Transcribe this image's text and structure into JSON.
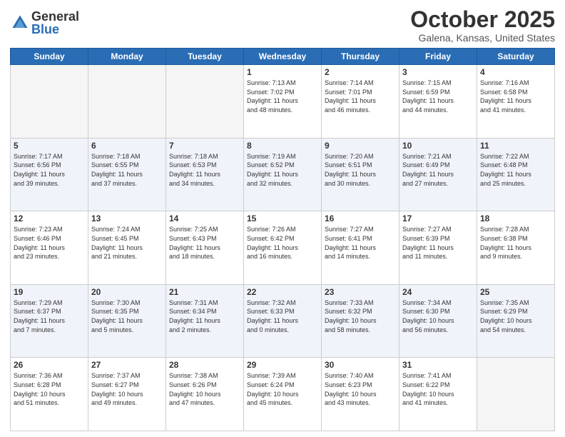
{
  "logo": {
    "general": "General",
    "blue": "Blue"
  },
  "title": "October 2025",
  "location": "Galena, Kansas, United States",
  "days_of_week": [
    "Sunday",
    "Monday",
    "Tuesday",
    "Wednesday",
    "Thursday",
    "Friday",
    "Saturday"
  ],
  "weeks": [
    [
      {
        "day": "",
        "info": ""
      },
      {
        "day": "",
        "info": ""
      },
      {
        "day": "",
        "info": ""
      },
      {
        "day": "1",
        "info": "Sunrise: 7:13 AM\nSunset: 7:02 PM\nDaylight: 11 hours\nand 48 minutes."
      },
      {
        "day": "2",
        "info": "Sunrise: 7:14 AM\nSunset: 7:01 PM\nDaylight: 11 hours\nand 46 minutes."
      },
      {
        "day": "3",
        "info": "Sunrise: 7:15 AM\nSunset: 6:59 PM\nDaylight: 11 hours\nand 44 minutes."
      },
      {
        "day": "4",
        "info": "Sunrise: 7:16 AM\nSunset: 6:58 PM\nDaylight: 11 hours\nand 41 minutes."
      }
    ],
    [
      {
        "day": "5",
        "info": "Sunrise: 7:17 AM\nSunset: 6:56 PM\nDaylight: 11 hours\nand 39 minutes."
      },
      {
        "day": "6",
        "info": "Sunrise: 7:18 AM\nSunset: 6:55 PM\nDaylight: 11 hours\nand 37 minutes."
      },
      {
        "day": "7",
        "info": "Sunrise: 7:18 AM\nSunset: 6:53 PM\nDaylight: 11 hours\nand 34 minutes."
      },
      {
        "day": "8",
        "info": "Sunrise: 7:19 AM\nSunset: 6:52 PM\nDaylight: 11 hours\nand 32 minutes."
      },
      {
        "day": "9",
        "info": "Sunrise: 7:20 AM\nSunset: 6:51 PM\nDaylight: 11 hours\nand 30 minutes."
      },
      {
        "day": "10",
        "info": "Sunrise: 7:21 AM\nSunset: 6:49 PM\nDaylight: 11 hours\nand 27 minutes."
      },
      {
        "day": "11",
        "info": "Sunrise: 7:22 AM\nSunset: 6:48 PM\nDaylight: 11 hours\nand 25 minutes."
      }
    ],
    [
      {
        "day": "12",
        "info": "Sunrise: 7:23 AM\nSunset: 6:46 PM\nDaylight: 11 hours\nand 23 minutes."
      },
      {
        "day": "13",
        "info": "Sunrise: 7:24 AM\nSunset: 6:45 PM\nDaylight: 11 hours\nand 21 minutes."
      },
      {
        "day": "14",
        "info": "Sunrise: 7:25 AM\nSunset: 6:43 PM\nDaylight: 11 hours\nand 18 minutes."
      },
      {
        "day": "15",
        "info": "Sunrise: 7:26 AM\nSunset: 6:42 PM\nDaylight: 11 hours\nand 16 minutes."
      },
      {
        "day": "16",
        "info": "Sunrise: 7:27 AM\nSunset: 6:41 PM\nDaylight: 11 hours\nand 14 minutes."
      },
      {
        "day": "17",
        "info": "Sunrise: 7:27 AM\nSunset: 6:39 PM\nDaylight: 11 hours\nand 11 minutes."
      },
      {
        "day": "18",
        "info": "Sunrise: 7:28 AM\nSunset: 6:38 PM\nDaylight: 11 hours\nand 9 minutes."
      }
    ],
    [
      {
        "day": "19",
        "info": "Sunrise: 7:29 AM\nSunset: 6:37 PM\nDaylight: 11 hours\nand 7 minutes."
      },
      {
        "day": "20",
        "info": "Sunrise: 7:30 AM\nSunset: 6:35 PM\nDaylight: 11 hours\nand 5 minutes."
      },
      {
        "day": "21",
        "info": "Sunrise: 7:31 AM\nSunset: 6:34 PM\nDaylight: 11 hours\nand 2 minutes."
      },
      {
        "day": "22",
        "info": "Sunrise: 7:32 AM\nSunset: 6:33 PM\nDaylight: 11 hours\nand 0 minutes."
      },
      {
        "day": "23",
        "info": "Sunrise: 7:33 AM\nSunset: 6:32 PM\nDaylight: 10 hours\nand 58 minutes."
      },
      {
        "day": "24",
        "info": "Sunrise: 7:34 AM\nSunset: 6:30 PM\nDaylight: 10 hours\nand 56 minutes."
      },
      {
        "day": "25",
        "info": "Sunrise: 7:35 AM\nSunset: 6:29 PM\nDaylight: 10 hours\nand 54 minutes."
      }
    ],
    [
      {
        "day": "26",
        "info": "Sunrise: 7:36 AM\nSunset: 6:28 PM\nDaylight: 10 hours\nand 51 minutes."
      },
      {
        "day": "27",
        "info": "Sunrise: 7:37 AM\nSunset: 6:27 PM\nDaylight: 10 hours\nand 49 minutes."
      },
      {
        "day": "28",
        "info": "Sunrise: 7:38 AM\nSunset: 6:26 PM\nDaylight: 10 hours\nand 47 minutes."
      },
      {
        "day": "29",
        "info": "Sunrise: 7:39 AM\nSunset: 6:24 PM\nDaylight: 10 hours\nand 45 minutes."
      },
      {
        "day": "30",
        "info": "Sunrise: 7:40 AM\nSunset: 6:23 PM\nDaylight: 10 hours\nand 43 minutes."
      },
      {
        "day": "31",
        "info": "Sunrise: 7:41 AM\nSunset: 6:22 PM\nDaylight: 10 hours\nand 41 minutes."
      },
      {
        "day": "",
        "info": ""
      }
    ]
  ]
}
